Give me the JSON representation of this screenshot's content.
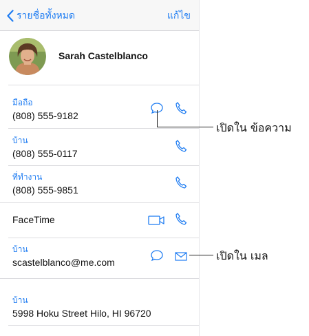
{
  "navbar": {
    "back_label": "รายชื่อทั้งหมด",
    "edit_label": "แก้ไข"
  },
  "contact": {
    "name": "Sarah Castelblanco"
  },
  "phones": [
    {
      "label": "มือถือ",
      "value": "(808) 555-9182"
    },
    {
      "label": "บ้าน",
      "value": "(808) 555-0117"
    },
    {
      "label": "ที่ทำงาน",
      "value": "(808) 555-9851"
    }
  ],
  "facetime": {
    "label": "FaceTime"
  },
  "email": {
    "label": "บ้าน",
    "value": "scastelblanco@me.com"
  },
  "address": {
    "label": "บ้าน",
    "value": "5998 Hoku Street Hilo, HI 96720"
  },
  "callouts": {
    "message": "เปิดใน ข้อความ",
    "mail": "เปิดใน เมล"
  },
  "icons": {
    "back": "chevron-left-icon",
    "message": "message-bubble-icon",
    "phone": "phone-icon",
    "video": "video-camera-icon",
    "mail": "envelope-icon"
  },
  "colors": {
    "accent": "#1e7cf2",
    "navbar_bg": "#f7f7f7",
    "separator": "#dcdce0"
  }
}
